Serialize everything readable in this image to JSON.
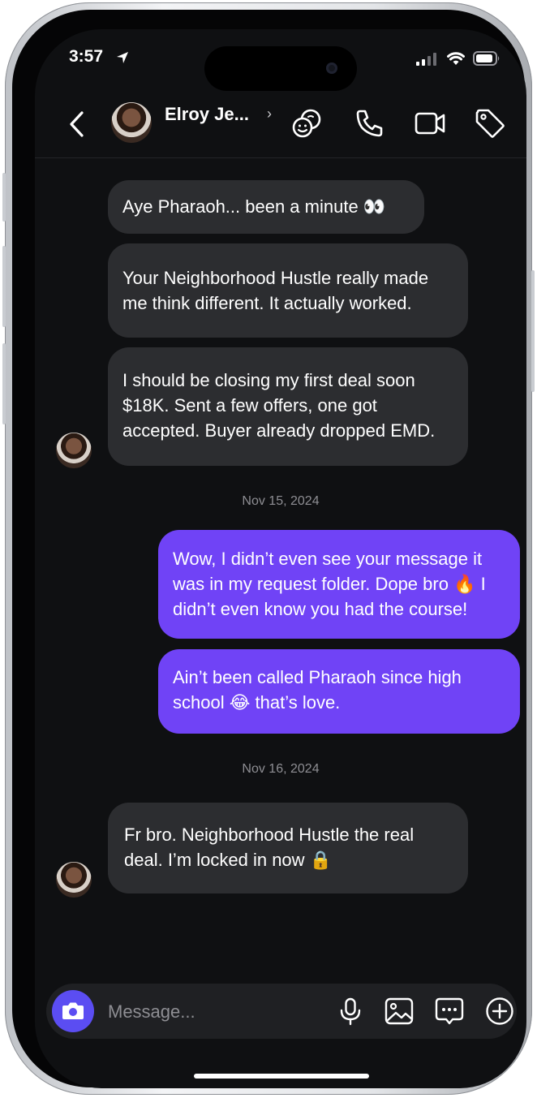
{
  "status_bar": {
    "time": "3:57"
  },
  "header": {
    "contact_name": "Elroy Je...",
    "chevron": "›"
  },
  "messages": [
    {
      "type": "in",
      "text": "Aye Pharaoh... been a minute 👀"
    },
    {
      "type": "in",
      "text": "Your Neighborhood Hustle really made me think different. It actually worked."
    },
    {
      "type": "in",
      "text": "I should be closing my first deal soon $18K. Sent a few offers, one got accepted. Buyer already dropped EMD."
    },
    {
      "type": "date",
      "text": "Nov 15, 2024"
    },
    {
      "type": "out",
      "text": "Wow, I didn’t even see your message it was in my request folder. Dope bro 🔥 I didn’t even know you had the course!"
    },
    {
      "type": "out",
      "text": "Ain’t been called Pharaoh since high school 😂 that’s love."
    },
    {
      "type": "date",
      "text": "Nov 16, 2024"
    },
    {
      "type": "in",
      "text": "Fr bro. Neighborhood Hustle the real deal. I’m locked in now 🔒"
    }
  ],
  "composer": {
    "placeholder": "Message..."
  },
  "icons": {
    "header": [
      "back-icon",
      "stickers-icon",
      "phone-icon",
      "video-icon",
      "tag-icon"
    ],
    "composer": [
      "camera-icon",
      "microphone-icon",
      "image-icon",
      "chat-bubble-icon",
      "plus-circle-icon"
    ]
  },
  "colors": {
    "outgoing_bubble": "#7043f6",
    "incoming_bubble": "#2c2d30",
    "background": "#0f1012",
    "camera_button": "#5b4df2"
  }
}
